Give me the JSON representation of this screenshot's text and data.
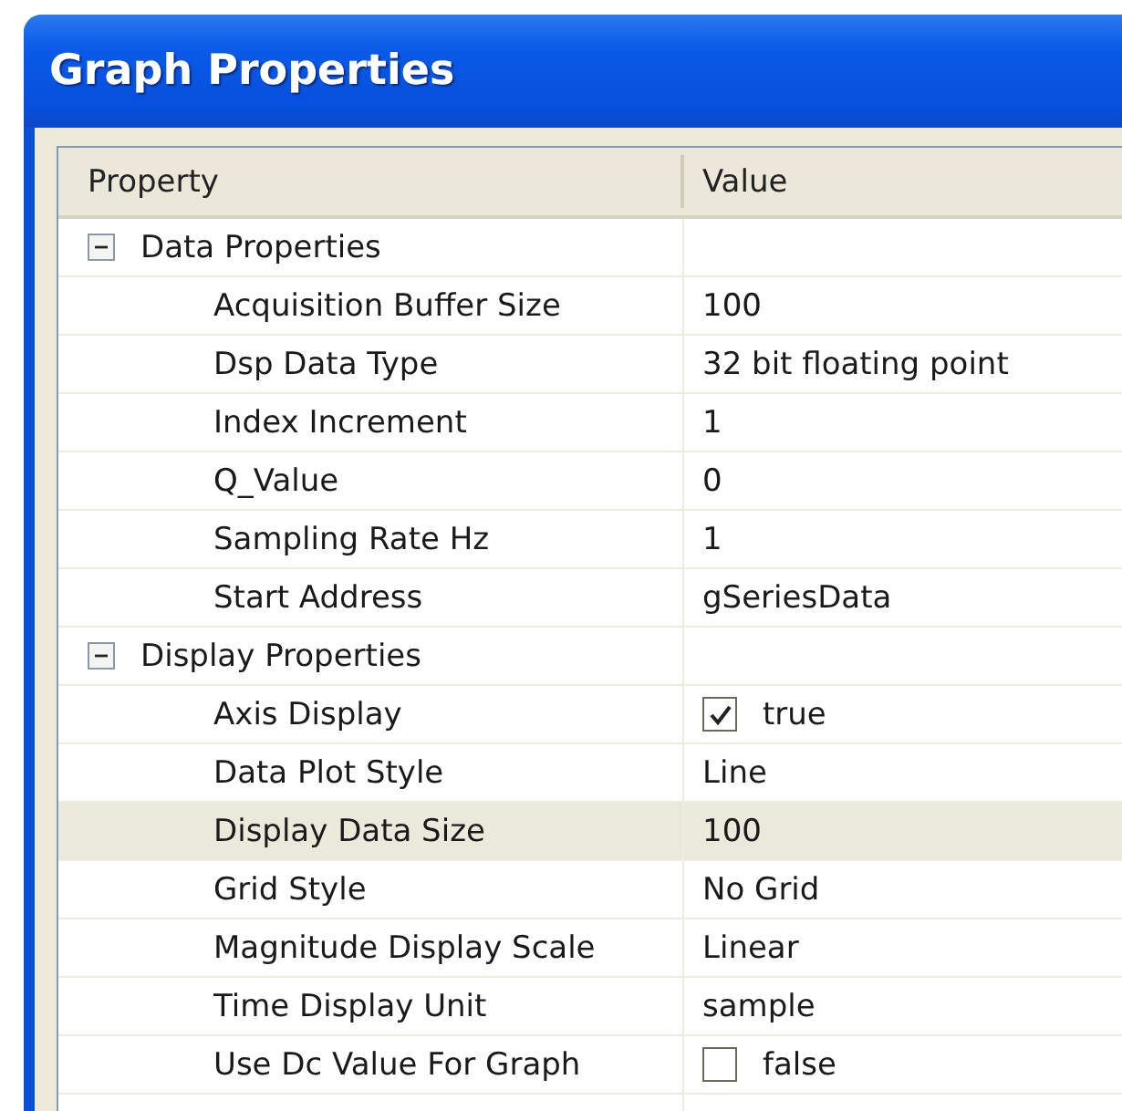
{
  "window": {
    "title": "Graph Properties"
  },
  "columns": [
    "Property",
    "Value"
  ],
  "groups": [
    {
      "name": "Data Properties",
      "expanded": true,
      "children": [
        {
          "name": "Acquisition Buffer Size",
          "kind": "text",
          "value": "100",
          "selected": false
        },
        {
          "name": "Dsp Data Type",
          "kind": "text",
          "value": "32 bit floating point",
          "selected": false
        },
        {
          "name": "Index Increment",
          "kind": "text",
          "value": "1",
          "selected": false
        },
        {
          "name": "Q_Value",
          "kind": "text",
          "value": "0",
          "selected": false
        },
        {
          "name": "Sampling Rate Hz",
          "kind": "text",
          "value": "1",
          "selected": false
        },
        {
          "name": "Start Address",
          "kind": "text",
          "value": "gSeriesData",
          "selected": false
        }
      ]
    },
    {
      "name": "Display Properties",
      "expanded": true,
      "children": [
        {
          "name": "Axis Display",
          "kind": "checkbox",
          "checked": true,
          "value": "true",
          "selected": false
        },
        {
          "name": "Data Plot Style",
          "kind": "text",
          "value": "Line",
          "selected": false
        },
        {
          "name": "Display Data Size",
          "kind": "text",
          "value": "100",
          "selected": true
        },
        {
          "name": "Grid Style",
          "kind": "text",
          "value": "No Grid",
          "selected": false
        },
        {
          "name": "Magnitude Display Scale",
          "kind": "text",
          "value": "Linear",
          "selected": false
        },
        {
          "name": "Time Display Unit",
          "kind": "text",
          "value": "sample",
          "selected": false
        },
        {
          "name": "Use Dc Value For Graph",
          "kind": "checkbox",
          "checked": false,
          "value": "false",
          "selected": false
        }
      ]
    }
  ]
}
